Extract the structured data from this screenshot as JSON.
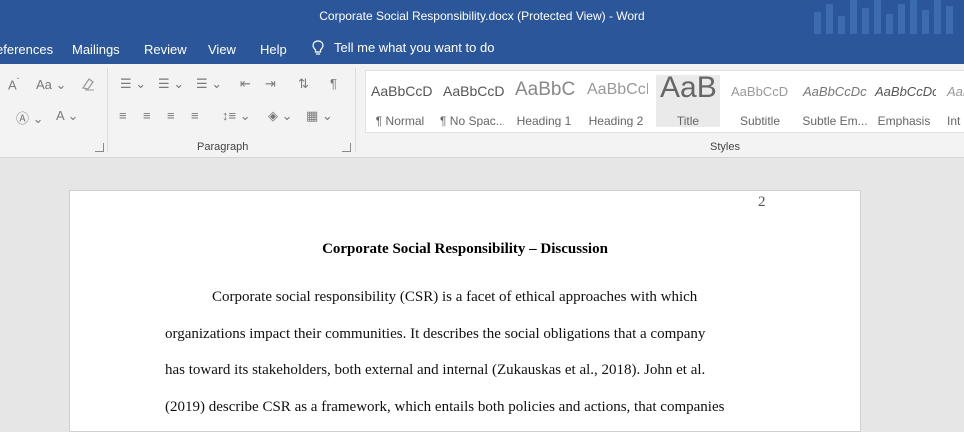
{
  "window": {
    "title": "Corporate Social Responsibility.docx (Protected View)  -  Word"
  },
  "tabs": [
    {
      "label": "eferences"
    },
    {
      "label": "Mailings"
    },
    {
      "label": "Review"
    },
    {
      "label": "View"
    },
    {
      "label": "Help"
    }
  ],
  "tell_me": {
    "label": "Tell me what you want to do",
    "icon": "lightbulb-icon"
  },
  "ribbon": {
    "groups": {
      "paragraph": "Paragraph",
      "styles": "Styles"
    },
    "font_buttons": {
      "case_label": "Aa",
      "font_color_label": "A"
    },
    "style_tiles": [
      {
        "preview": "AaBbCcDc",
        "name": "¶ Normal"
      },
      {
        "preview": "AaBbCcDc",
        "name": "¶ No Spac..."
      },
      {
        "preview": "AaBbCc",
        "name": "Heading 1"
      },
      {
        "preview": "AaBbCcD",
        "name": "Heading 2"
      },
      {
        "preview": "AaB",
        "name": "Title"
      },
      {
        "preview": "AaBbCcD",
        "name": "Subtitle"
      },
      {
        "preview": "AaBbCcDc",
        "name": "Subtle Em..."
      },
      {
        "preview": "AaBbCcDc",
        "name": "Emphasis"
      },
      {
        "preview": "AaBbCcDc",
        "name": "Int"
      }
    ]
  },
  "document": {
    "page_number": "2",
    "title": "Corporate Social Responsibility – Discussion",
    "lines": [
      "Corporate social responsibility (CSR) is a facet of ethical approaches with which",
      "organizations impact their communities. It describes the social obligations that a company",
      "has toward its stakeholders, both external and internal (Zukauskas et al., 2018). John et al.",
      "(2019) describe CSR as a framework, which entails both policies and actions, that companies"
    ]
  },
  "colors": {
    "titlebar": "#2b579a",
    "ribbon": "#f3f3f3",
    "canvas": "#e6e6e6"
  }
}
